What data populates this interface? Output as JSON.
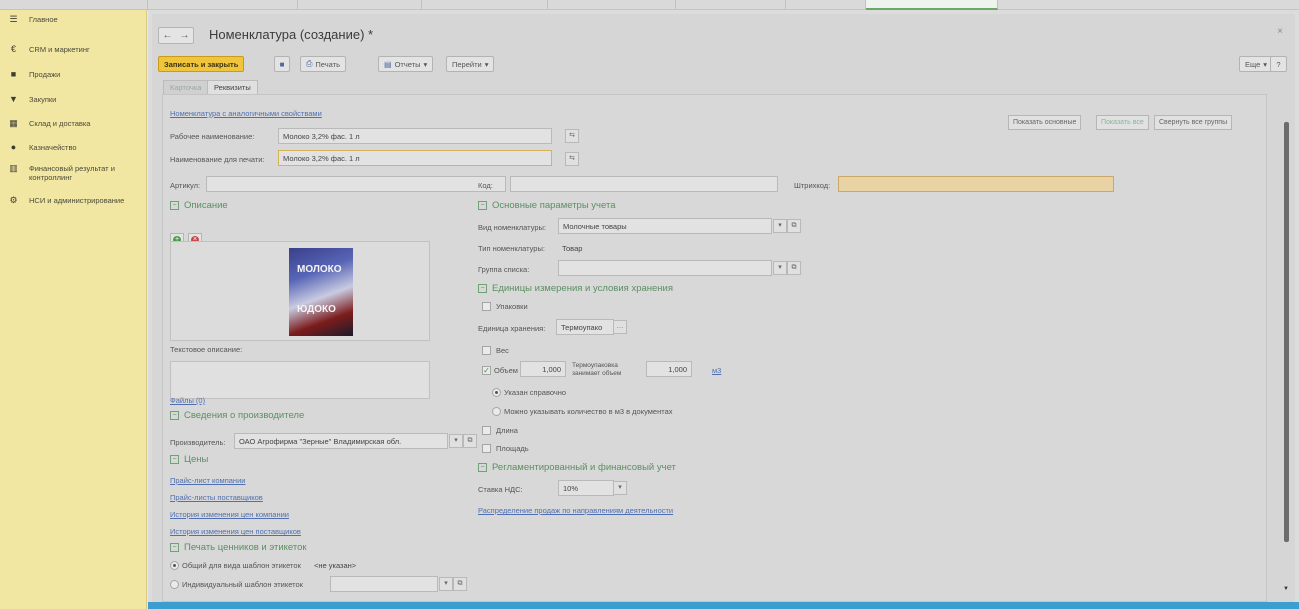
{
  "sidebar": {
    "items": [
      {
        "icon": "menu-icon",
        "glyph": "☰",
        "label": "Главное"
      },
      {
        "icon": "crm-icon",
        "glyph": "€",
        "label": "CRM и маркетинг"
      },
      {
        "icon": "sales-icon",
        "glyph": "■",
        "label": "Продажи"
      },
      {
        "icon": "cart-icon",
        "glyph": "▼",
        "label": "Закупки"
      },
      {
        "icon": "warehouse-icon",
        "glyph": "▦",
        "label": "Склад и доставка"
      },
      {
        "icon": "cash-icon",
        "glyph": "●",
        "label": "Казначейство"
      },
      {
        "icon": "finance-icon",
        "glyph": "▥",
        "label": "Финансовый результат и контроллинг"
      },
      {
        "icon": "settings-icon",
        "glyph": "⚙",
        "label": "НСИ и администрирование"
      }
    ]
  },
  "header": {
    "back": "←",
    "forward": "→",
    "title": "Номенклатура (создание) *",
    "close": "×"
  },
  "toolbar": {
    "save_close": "Записать и закрыть",
    "save_icon": "save-icon",
    "print": "Печать",
    "reports": "Отчеты",
    "goto": "Перейти",
    "more": "Еще",
    "help": "?"
  },
  "tabs": {
    "cards": "Карточка",
    "requisites": "Реквизиты"
  },
  "view_buttons": {
    "show_main": "Показать основные",
    "show_all": "Показать все",
    "collapse_all": "Свернуть все группы"
  },
  "form": {
    "analog_link": "Номенклатура с аналогичными свойствами",
    "work_name_label": "Рабочее наименование:",
    "work_name_value": "Молоко 3,2% фас. 1 л",
    "print_name_label": "Наименование для печати:",
    "print_name_value": "Молоко 3,2% фас. 1 л",
    "article_label": "Артикул:",
    "article_value": "",
    "code_label": "Код:",
    "code_value": "",
    "barcode_label": "Штрихкод:",
    "barcode_value": ""
  },
  "description": {
    "section": "Описание",
    "photo_text_top": "МОЛОКО",
    "photo_text_bottom": "ЮДОКО",
    "text_desc_label": "Текстовое описание:",
    "files_link": "Файлы (0)"
  },
  "manufacturer": {
    "section": "Сведения о производителе",
    "label": "Производитель:",
    "value": "ОАО Агрофирма \"Зерные\" Владимирская обл."
  },
  "prices": {
    "section": "Цены",
    "links": [
      "Прайс-лист компании",
      "Прайс-листы поставщиков",
      "История изменения цен компании",
      "История изменения цен поставщиков"
    ]
  },
  "labels_print": {
    "section": "Печать ценников и этикеток",
    "general_label": "Общий для вида шаблон этикеток",
    "general_value": "<не указан>",
    "individual_label": "Индивидуальный шаблон этикеток"
  },
  "accounting": {
    "section": "Основные параметры учета",
    "kind_label": "Вид номенклатуры:",
    "kind_value": "Молочные товары",
    "type_label": "Тип номенклатуры:",
    "type_value": "Товар",
    "list_group_label": "Группа списка:",
    "list_group_value": ""
  },
  "units": {
    "section": "Единицы измерения и условия хранения",
    "packages": "Упаковки",
    "storage_unit_label": "Единица хранения:",
    "storage_unit_value": "Термоупако",
    "weight": "Вес",
    "volume": "Объем",
    "volume_value": "1,000",
    "thermo_label": "Термоупаковка занимает объем",
    "thermo_value": "1,000",
    "volume_unit": "м3",
    "radio_ref": "Указан справочно",
    "radio_doc": "Можно указывать количество в м3 в документах",
    "length": "Длина",
    "area": "Площадь"
  },
  "regulated": {
    "section": "Регламентированный и финансовый учет",
    "vat_label": "Ставка НДС:",
    "vat_value": "10%",
    "distribution_link": "Распределение продаж по направлениям деятельности"
  }
}
